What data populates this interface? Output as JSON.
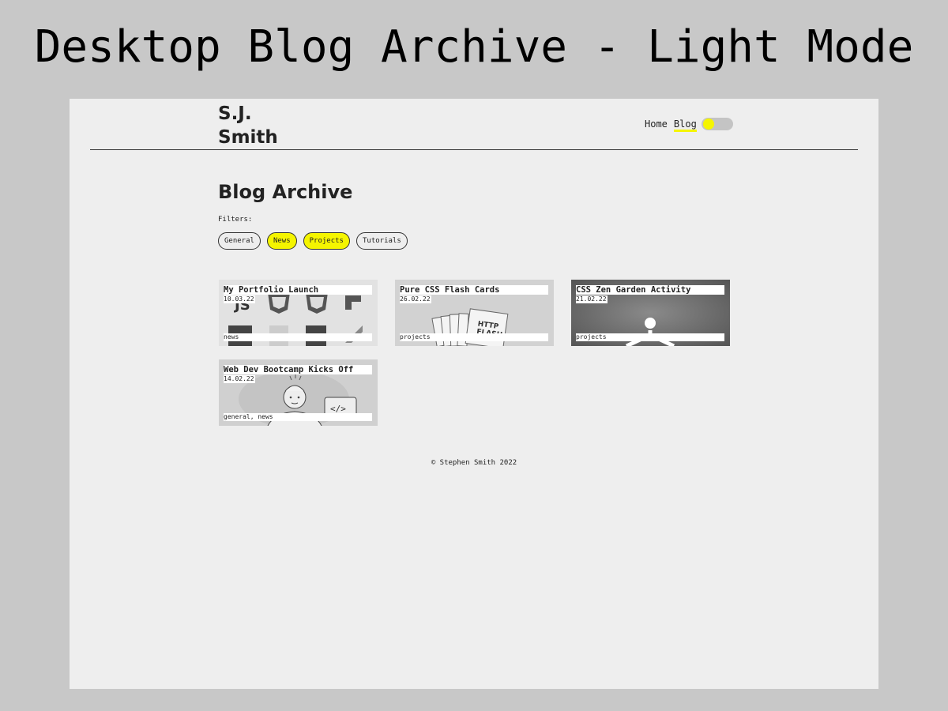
{
  "caption": "Desktop Blog Archive - Light Mode",
  "site": {
    "brand_line1": "S.J.",
    "brand_line2": "Smith",
    "nav": {
      "home": "Home",
      "blog": "Blog"
    },
    "theme_toggle": {
      "state": "light",
      "knob_color": "#f5f500"
    }
  },
  "archive": {
    "title": "Blog Archive",
    "filters_label": "Filters:",
    "filters": [
      {
        "label": "General",
        "active": false
      },
      {
        "label": "News",
        "active": true
      },
      {
        "label": "Projects",
        "active": true
      },
      {
        "label": "Tutorials",
        "active": false
      }
    ],
    "posts": [
      {
        "title": "My Portfolio Launch",
        "date": "10.03.22",
        "tags": "news",
        "art": "tech-logos-icon"
      },
      {
        "title": "Pure CSS Flash Cards",
        "date": "26.02.22",
        "tags": "projects",
        "art": "flash-cards-icon"
      },
      {
        "title": "CSS Zen Garden Activity",
        "date": "21.02.22",
        "tags": "projects",
        "art": "meditating-figure-icon"
      },
      {
        "title": "Web Dev Bootcamp Kicks Off",
        "date": "14.02.22",
        "tags": "general, news",
        "art": "developer-sketch-icon"
      }
    ]
  },
  "footer": {
    "copyright": "© Stephen Smith 2022"
  },
  "colors": {
    "accent": "#f5f500",
    "background": "#eeeeee",
    "text": "#222222"
  }
}
